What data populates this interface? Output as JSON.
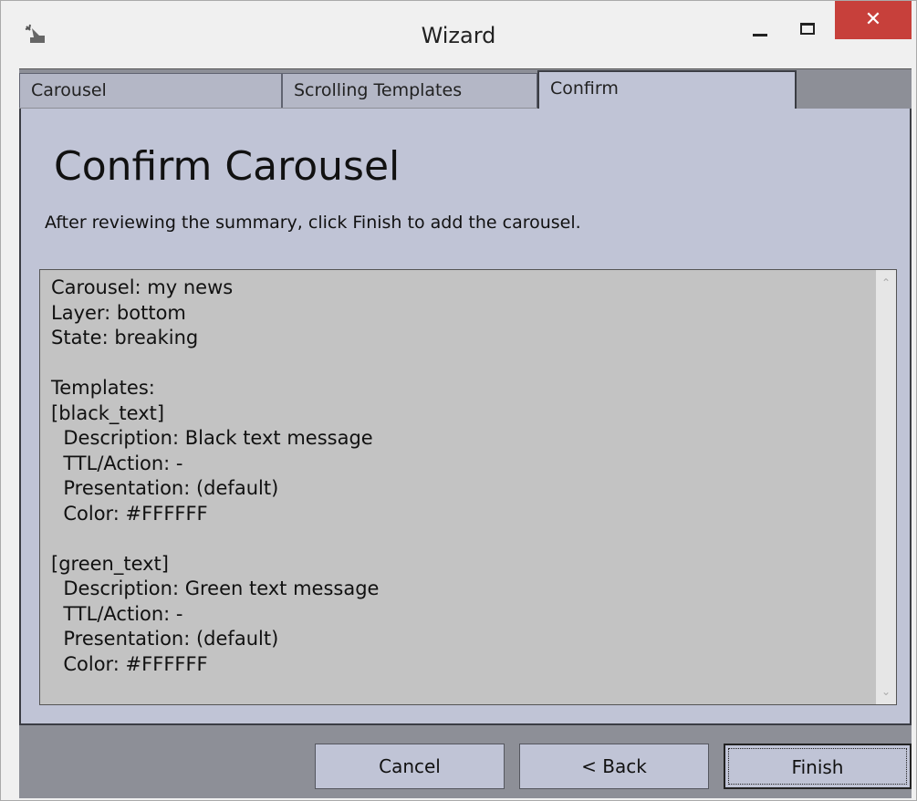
{
  "window": {
    "title": "Wizard",
    "close_glyph": "✕",
    "app_icon": "wizard-wand-icon"
  },
  "tabs": [
    {
      "label": "Carousel",
      "active": false
    },
    {
      "label": "Scrolling Templates",
      "active": false
    },
    {
      "label": "Confirm",
      "active": true
    }
  ],
  "page": {
    "heading": "Confirm Carousel",
    "instructions": "After reviewing the summary, click Finish to add the carousel."
  },
  "summary": {
    "text": "Carousel: my news\nLayer: bottom\nState: breaking\n\nTemplates:\n[black_text]\n  Description: Black text message\n  TTL/Action: -\n  Presentation: (default)\n  Color: #FFFFFF\n\n[green_text]\n  Description: Green text message\n  TTL/Action: -\n  Presentation: (default)\n  Color: #FFFFFF"
  },
  "buttons": {
    "cancel": "Cancel",
    "back": "< Back",
    "finish": "Finish"
  },
  "colors": {
    "panel": "#c0c4d6",
    "strip": "#8d8f97",
    "close": "#c7403b"
  }
}
